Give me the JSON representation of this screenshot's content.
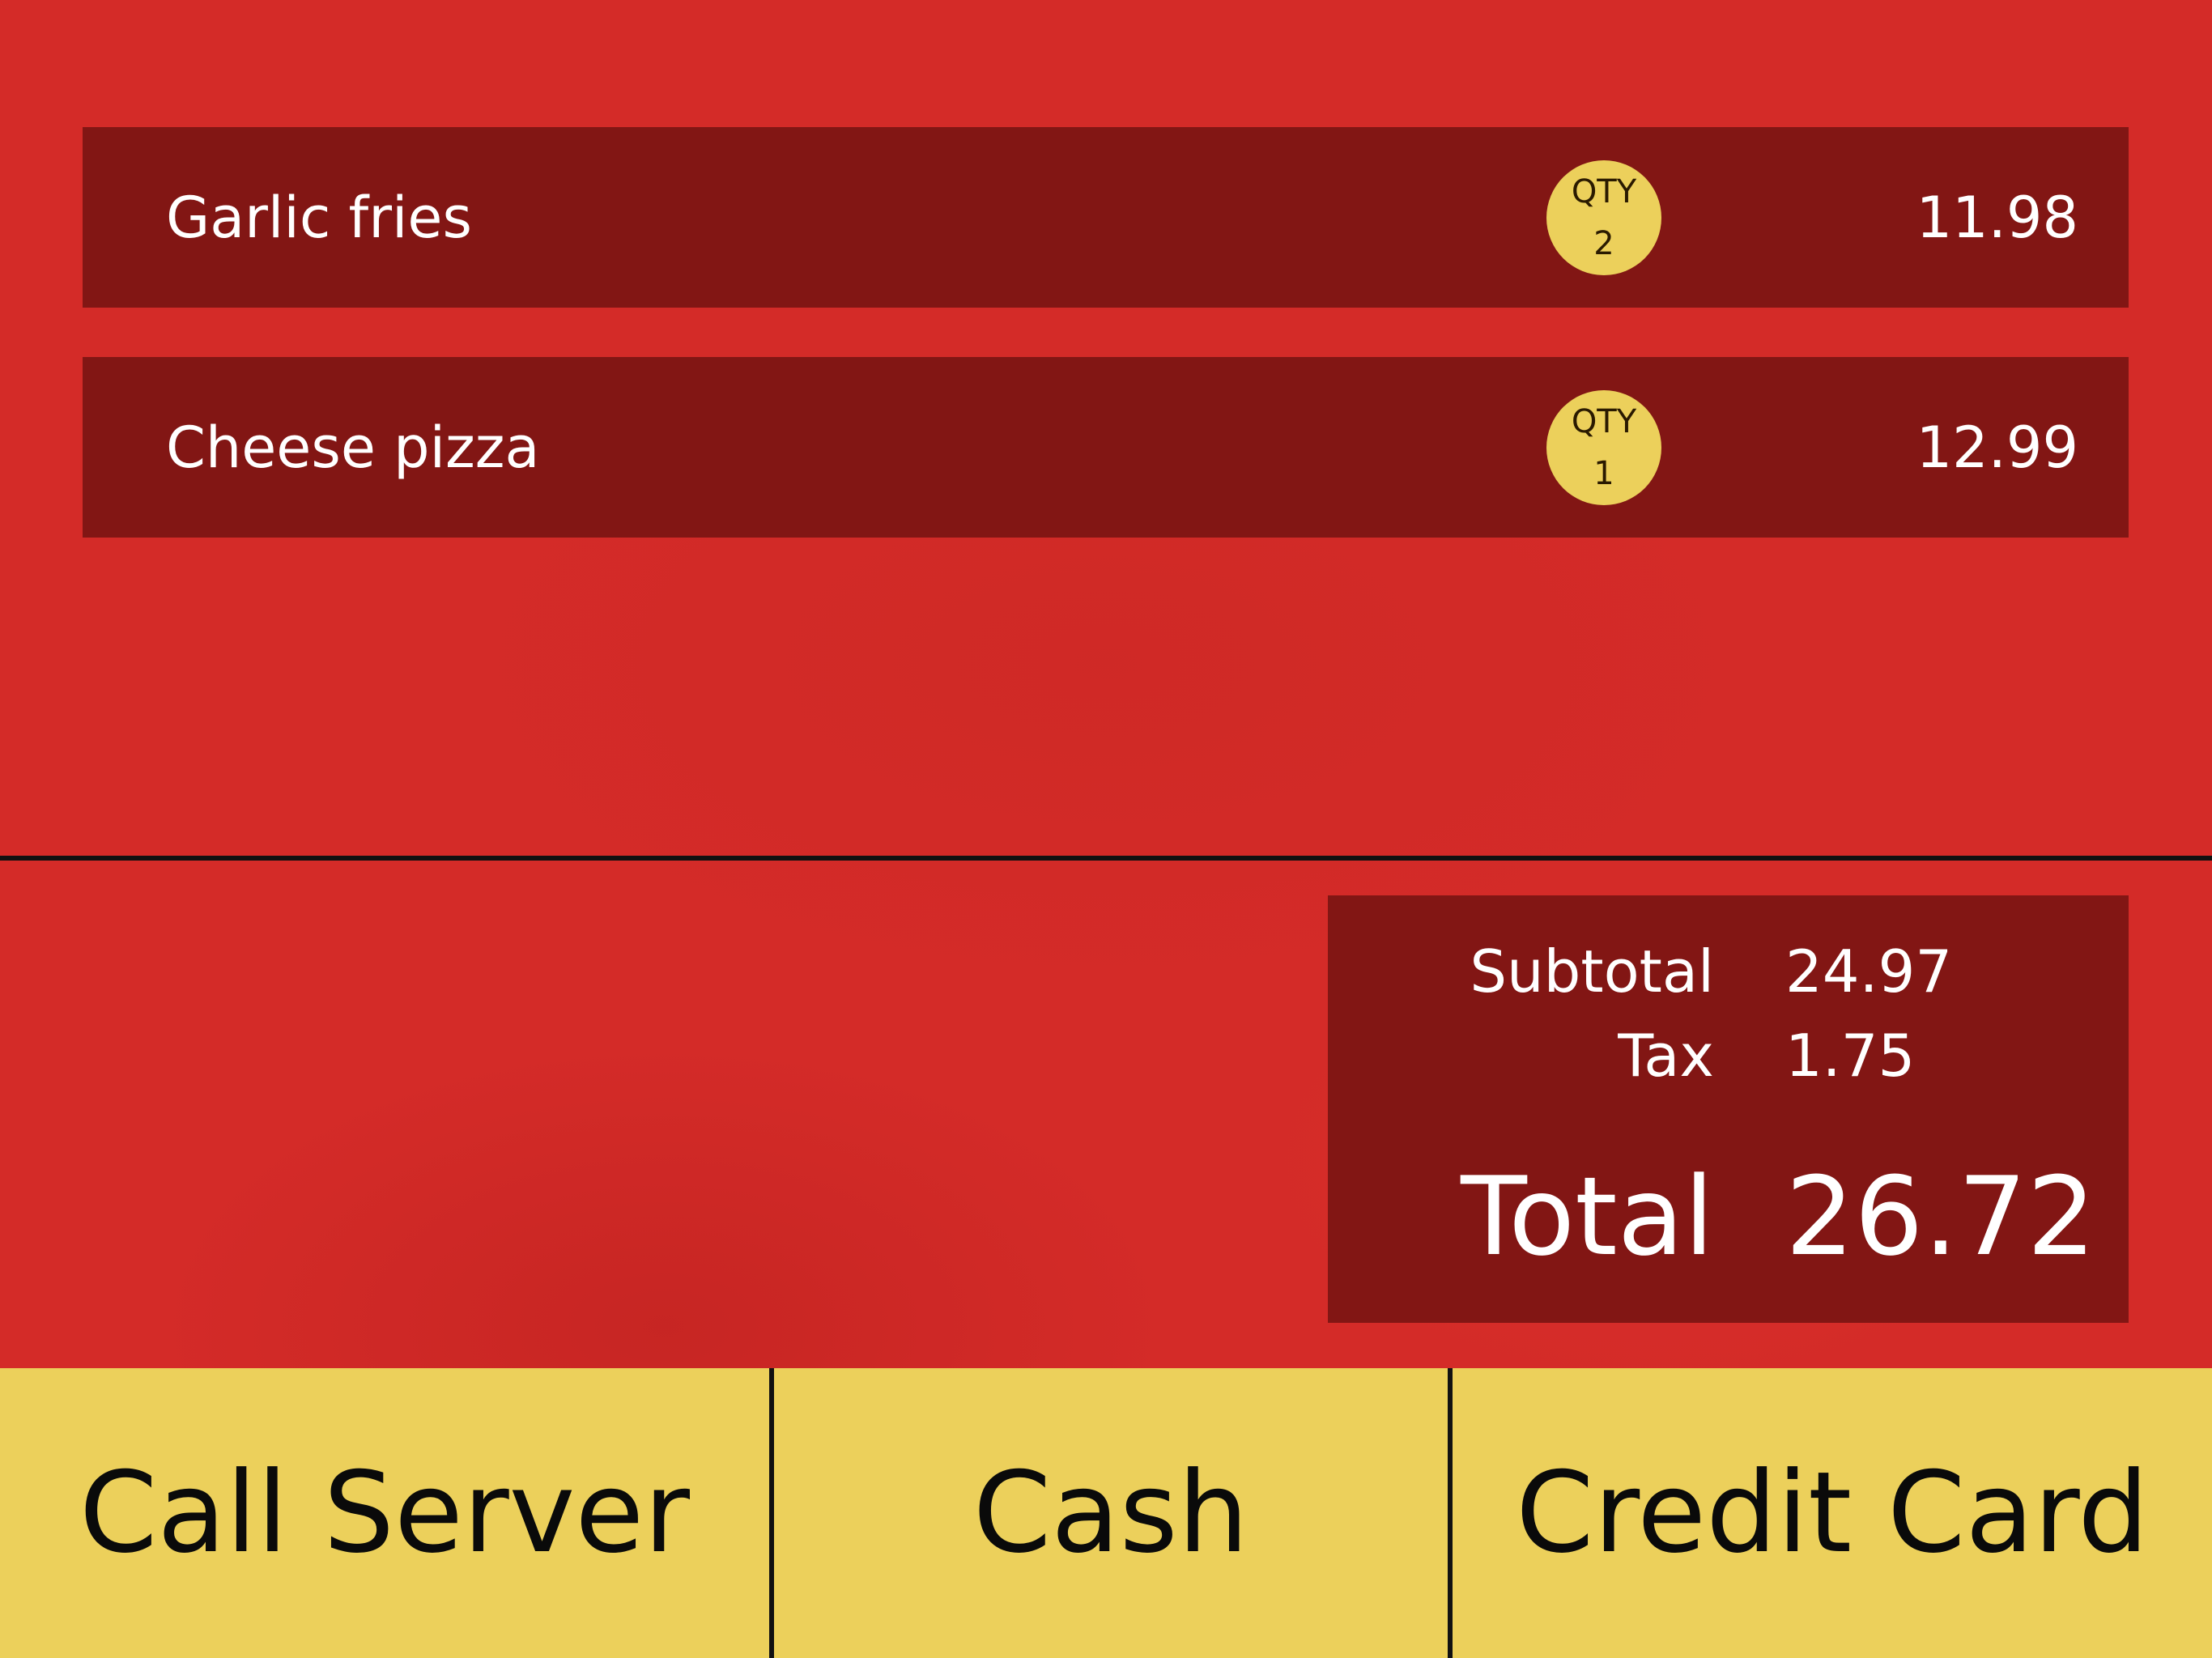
{
  "order": {
    "items": [
      {
        "name": "Garlic fries",
        "qty_label": "QTY",
        "qty": "2",
        "price": "11.98"
      },
      {
        "name": "Cheese pizza",
        "qty_label": "QTY",
        "qty": "1",
        "price": "12.99"
      }
    ]
  },
  "totals": {
    "subtotal_label": "Subtotal",
    "subtotal_value": "24.97",
    "tax_label": "Tax",
    "tax_value": "1.75",
    "total_label": "Total",
    "total_value": "26.72"
  },
  "actions": {
    "call_server": "Call Server",
    "cash": "Cash",
    "credit_card": "Credit Card"
  },
  "colors": {
    "background": "#d42b28",
    "panel": "#821614",
    "accent": "#ecd05b",
    "divider": "#111111"
  }
}
